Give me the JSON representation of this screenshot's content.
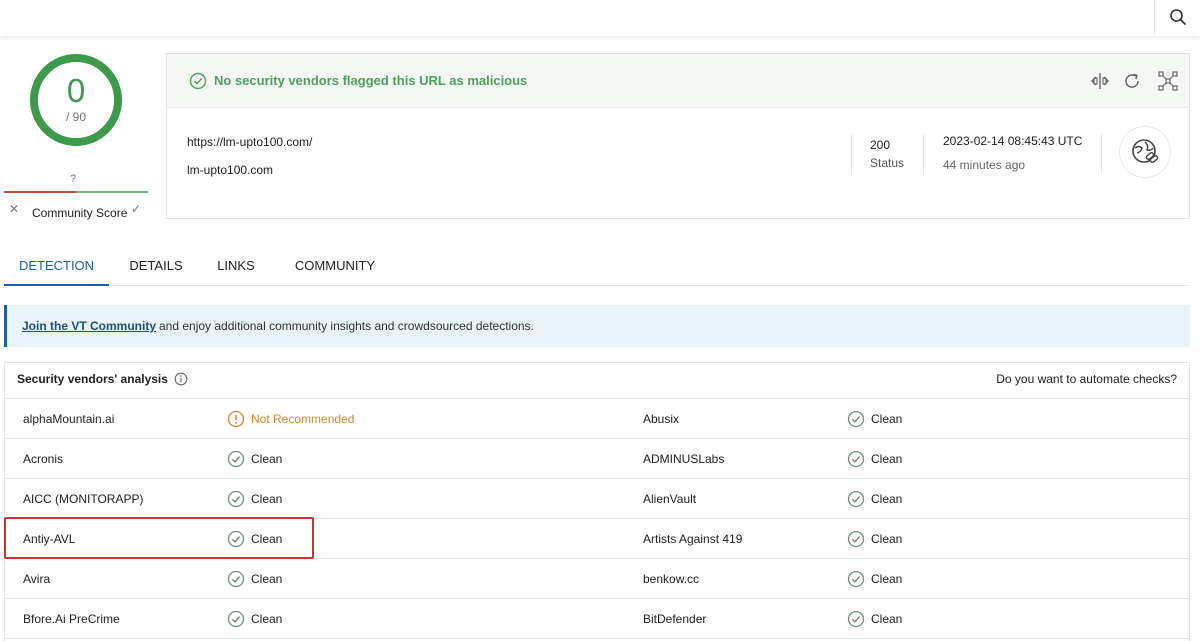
{
  "colors": {
    "accent": "#1d5fa8",
    "clean": "#4aa35a",
    "warn": "#cc8a2e",
    "highlight": "#c0392b"
  },
  "topbar": {
    "search_icon": "search-icon"
  },
  "score": {
    "value": "0",
    "total": "/ 90"
  },
  "community": {
    "question": "?",
    "label": "Community Score"
  },
  "summary": {
    "banner": "No security vendors flagged this URL as malicious",
    "url": "https://lm-upto100.com/",
    "domain": "lm-upto100.com",
    "status_code": "200",
    "status_label": "Status",
    "date": "2023-02-14 08:45:43 UTC",
    "ago": "44 minutes ago",
    "actions": [
      "compare-icon",
      "reanalyze-icon",
      "graph-icon"
    ]
  },
  "tabs": [
    {
      "label": "DETECTION",
      "active": true
    },
    {
      "label": "DETAILS",
      "active": false
    },
    {
      "label": "LINKS",
      "active": false
    },
    {
      "label": "COMMUNITY",
      "active": false
    }
  ],
  "join": {
    "link": "Join the VT Community",
    "text": "and enjoy additional community insights and crowdsourced detections."
  },
  "vendors": {
    "title": "Security vendors' analysis",
    "automate": "Do you want to automate checks?",
    "rows": [
      [
        {
          "name": "alphaMountain.ai",
          "result": "Not Recommended",
          "status": "warn"
        },
        {
          "name": "Abusix",
          "result": "Clean",
          "status": "clean"
        }
      ],
      [
        {
          "name": "Acronis",
          "result": "Clean",
          "status": "clean"
        },
        {
          "name": "ADMINUSLabs",
          "result": "Clean",
          "status": "clean"
        }
      ],
      [
        {
          "name": "AICC (MONITORAPP)",
          "result": "Clean",
          "status": "clean"
        },
        {
          "name": "AlienVault",
          "result": "Clean",
          "status": "clean"
        }
      ],
      [
        {
          "name": "Antiy-AVL",
          "result": "Clean",
          "status": "clean"
        },
        {
          "name": "Artists Against 419",
          "result": "Clean",
          "status": "clean"
        }
      ],
      [
        {
          "name": "Avira",
          "result": "Clean",
          "status": "clean"
        },
        {
          "name": "benkow.cc",
          "result": "Clean",
          "status": "clean"
        }
      ],
      [
        {
          "name": "Bfore.Ai PreCrime",
          "result": "Clean",
          "status": "clean"
        },
        {
          "name": "BitDefender",
          "result": "Clean",
          "status": "clean"
        }
      ]
    ]
  }
}
